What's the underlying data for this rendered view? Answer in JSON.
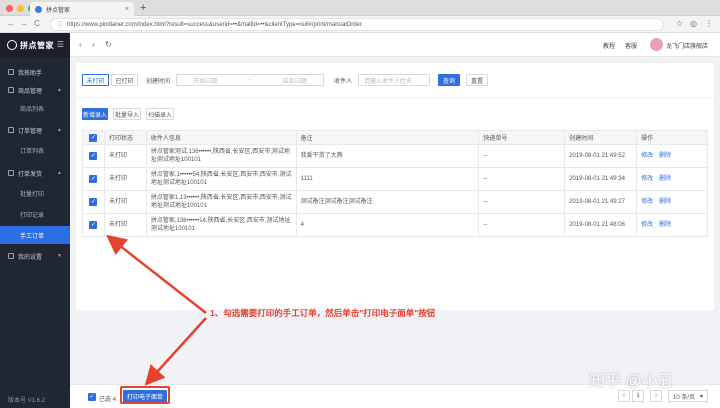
{
  "browser": {
    "tab_title": "拼点管家",
    "tab_close": "×",
    "new_tab": "+",
    "url": "https://www.pindianer.com/index.html?result=success&userid=••&mallId=••&clientType=null#/print/manualOrder",
    "back": "←",
    "forward": "→",
    "reload": "C",
    "lock": "ⓘ"
  },
  "sidebar": {
    "logo": "拼点管家",
    "items": [
      {
        "label": "我拣助手"
      },
      {
        "label": "商品管理"
      },
      {
        "label": "商品列表"
      },
      {
        "label": "订单管理"
      },
      {
        "label": "订单列表"
      },
      {
        "label": "打单发货"
      },
      {
        "label": "批量打印"
      },
      {
        "label": "打印记录"
      },
      {
        "label": "手工订单"
      },
      {
        "label": "我的设置"
      }
    ],
    "version": "版本号 V1.6.2"
  },
  "header": {
    "links": [
      "教程",
      "客服"
    ],
    "username": "龙飞门店旗舰店"
  },
  "filters": {
    "tabs": [
      "未打印",
      "已打印"
    ],
    "date_label": "创建时间",
    "start_placeholder": "开始日期",
    "to": "-",
    "end_placeholder": "结束日期",
    "receiver_label": "收件人",
    "receiver_placeholder": "请输入收件人姓名",
    "search": "查询",
    "reset": "重置"
  },
  "actions": [
    "新增录入",
    "批量导入",
    "扫描录入"
  ],
  "table": {
    "columns": [
      "打印状态",
      "收件人信息",
      "备注",
      "快递单号",
      "创建时间",
      "操作"
    ],
    "rows": [
      {
        "status": "未打印",
        "info": "拼点管家测试,136••••••,陕西省,长安区,西安市,测试地址测试地址100101",
        "note": "我爱干货了大燕",
        "tracking": "--",
        "created": "2019-08-01 21:49:52"
      },
      {
        "status": "未打印",
        "info": "拼点管家,1••••••54,陕西省,长安区,西安市,西安市,测试地址测试地址100101",
        "note": "1111",
        "tracking": "--",
        "created": "2019-08-01 21:49:34"
      },
      {
        "status": "未打印",
        "info": "拼点管家1,13••••••,陕西省,长安区,西安市,西安市,测试地址测试地址100101",
        "note": "测试备注测试备注测试备注",
        "tracking": "--",
        "created": "2019-08-01 21:49:27"
      },
      {
        "status": "未打印",
        "info": "拼点管家,136••••••14,陕西省,长安区,西安市,测试地址测试地址100101",
        "note": "4",
        "tracking": "--",
        "created": "2019-08-01 21:48:06"
      }
    ],
    "row_actions": [
      "修改",
      "删除"
    ]
  },
  "bottom": {
    "selected": "已选 4",
    "print_button": "打印电子面单",
    "prev": "<",
    "page": "1",
    "next": ">",
    "page_size": "10 条/页"
  },
  "annotation": {
    "callout": "1、勾选需要打印的手工订单，然后单击\"打印电子面单\"按钮",
    "watermark": "知乎 @小丑"
  },
  "colors": {
    "accent": "#2e6ee3",
    "sidebar": "#202733",
    "annotation": "#e5432f"
  }
}
